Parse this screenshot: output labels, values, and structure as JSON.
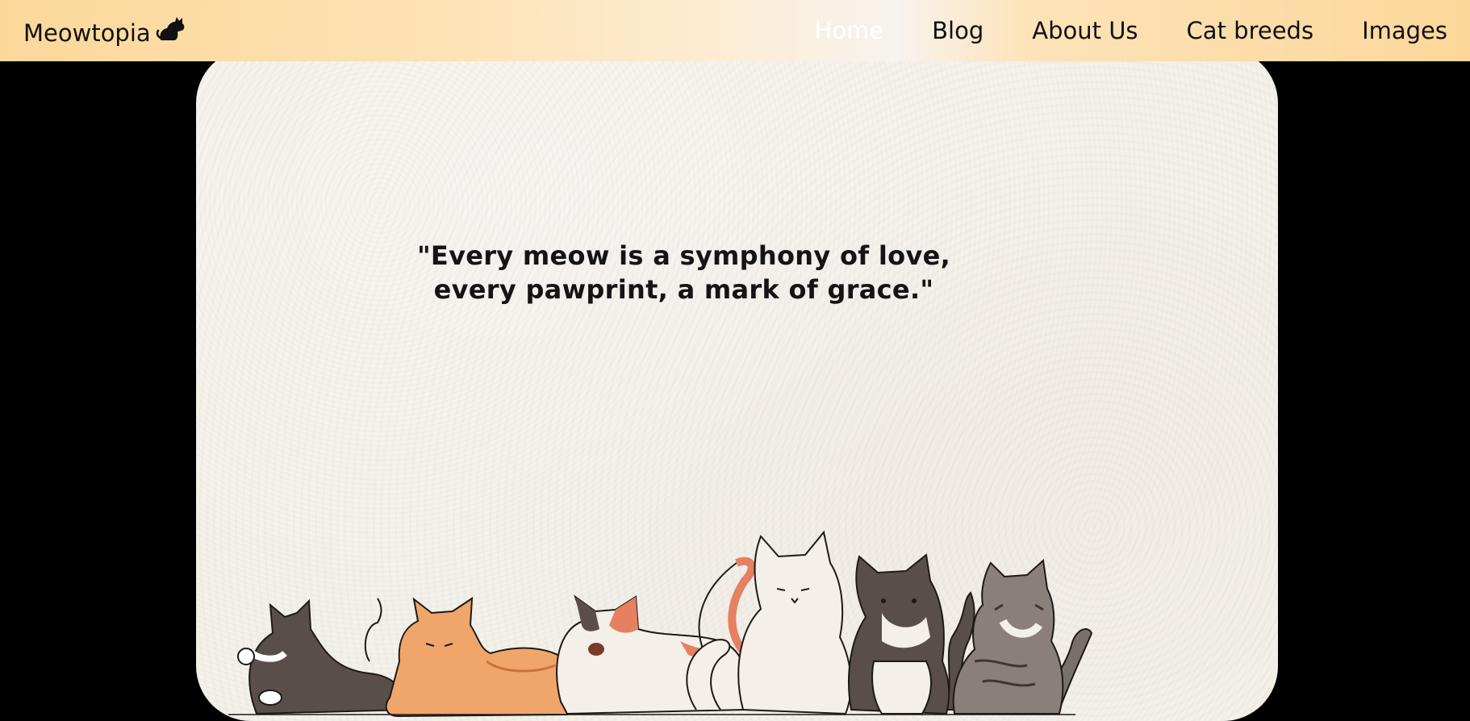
{
  "brand": {
    "name": "Meowtopia",
    "icon": "cat-icon"
  },
  "nav": {
    "items": [
      {
        "label": "Home",
        "active": true
      },
      {
        "label": "Blog",
        "active": false
      },
      {
        "label": "About Us",
        "active": false
      },
      {
        "label": "Cat breeds",
        "active": false
      },
      {
        "label": "Images",
        "active": false
      }
    ]
  },
  "hero": {
    "quote_line1": "\"Every meow is a symphony of love,",
    "quote_line2": "every pawprint, a mark of grace.\""
  },
  "colors": {
    "nav_gradient_start": "#fbd89a",
    "nav_gradient_mid": "#f7f3ee",
    "page_background": "#000000",
    "hero_background": "#f4f0ea",
    "active_link": "#ffffff"
  }
}
